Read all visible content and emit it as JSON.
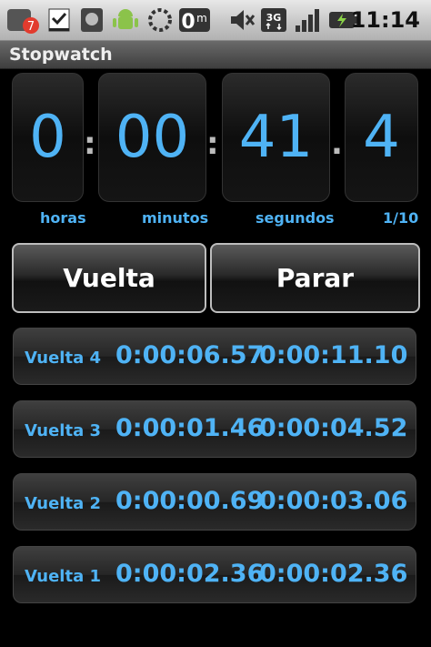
{
  "status_bar": {
    "time": "11:14",
    "notification_count": "7",
    "icons": [
      "app-notification-icon",
      "download-done-icon",
      "sd-card-icon",
      "android-debug-icon",
      "loading-icon",
      "zero-m-icon",
      "mute-icon",
      "3g-icon",
      "signal-icon",
      "battery-icon"
    ]
  },
  "app": {
    "title": "Stopwatch"
  },
  "display": {
    "hours": "0",
    "minutes": "00",
    "seconds": "41",
    "tenths": "4",
    "label_hours": "horas",
    "label_minutes": "minutos",
    "label_seconds": "segundos",
    "label_tenths": "1/10"
  },
  "buttons": {
    "lap": "Vuelta",
    "stop": "Parar"
  },
  "laps": [
    {
      "label": "Vuelta 4",
      "lap_time": "0:00:06.57",
      "total_time": "0:00:11.10"
    },
    {
      "label": "Vuelta 3",
      "lap_time": "0:00:01.46",
      "total_time": "0:00:04.52"
    },
    {
      "label": "Vuelta 2",
      "lap_time": "0:00:00.69",
      "total_time": "0:00:03.06"
    },
    {
      "label": "Vuelta 1",
      "lap_time": "0:00:02.36",
      "total_time": "0:00:02.36"
    }
  ],
  "colors": {
    "accent": "#4fb3f5",
    "background": "#000000"
  }
}
